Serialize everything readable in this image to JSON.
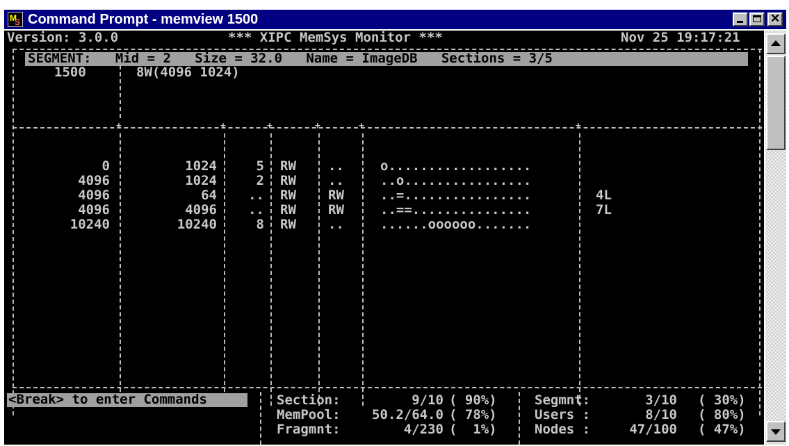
{
  "window": {
    "title": "Command Prompt - memview 1500",
    "icon": "ms-dos-prompt-icon",
    "controls": {
      "minimize": "minimize-icon",
      "maximize": "maximize-icon",
      "close": "✕"
    }
  },
  "header": {
    "version": "Version: 3.0.0",
    "app_name": "*** XIPC MemSys Monitor ***",
    "timestamp": "Nov 25 19:17:21"
  },
  "segment": {
    "summary": "SEGMENT:   Mid = 2   Size = 32.0   Name = ImageDB   Sections = 3/5",
    "id": "1500",
    "layout": "8W(4096 1024)"
  },
  "table": {
    "rows": [
      {
        "offset": "0",
        "size": "1024",
        "count": "5",
        "mode": "RW",
        "attr": "..",
        "map": "o..................",
        "locks": ""
      },
      {
        "offset": "4096",
        "size": "1024",
        "count": "2",
        "mode": "RW",
        "attr": "..",
        "map": "..o................",
        "locks": ""
      },
      {
        "offset": "4096",
        "size": "64",
        "count": "..",
        "mode": "RW",
        "attr": "RW",
        "map": "..=................",
        "locks": "4L"
      },
      {
        "offset": "4096",
        "size": "4096",
        "count": "..",
        "mode": "RW",
        "attr": "RW",
        "map": "..==...............",
        "locks": "7L"
      },
      {
        "offset": "10240",
        "size": "10240",
        "count": "8",
        "mode": "RW",
        "attr": "..",
        "map": "......oooooo.......",
        "locks": ""
      }
    ]
  },
  "footer": {
    "command_hint": "<Break> to enter Commands",
    "stats_left": [
      {
        "label": "Section:",
        "value": "9/10",
        "pct": "( 90%)"
      },
      {
        "label": "MemPool:",
        "value": "50.2/64.0",
        "pct": "( 78%)"
      },
      {
        "label": "Fragmnt:",
        "value": "4/230",
        "pct": "(  1%)"
      }
    ],
    "stats_right": [
      {
        "label": "Segmnt:",
        "value": "3/10",
        "pct": "( 30%)"
      },
      {
        "label": "Users :",
        "value": "8/10",
        "pct": "( 80%)"
      },
      {
        "label": "Nodes :",
        "value": "47/100",
        "pct": "( 47%)"
      }
    ]
  },
  "colors": {
    "titlebar": "#000080",
    "console_bg": "#000000",
    "console_text": "#c8c8c8",
    "highlight_bar": "#a0a0a0",
    "chrome": "#c0c0c0"
  }
}
